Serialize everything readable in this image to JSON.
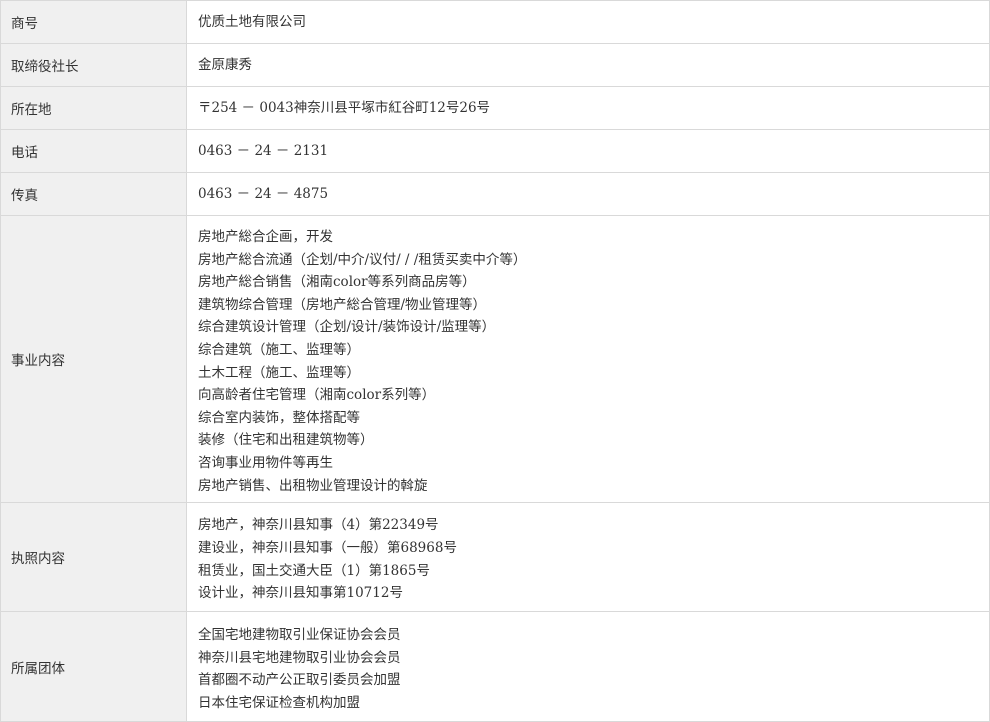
{
  "rows": [
    {
      "label": "商号",
      "lines": [
        "优质土地有限公司"
      ]
    },
    {
      "label": "取缔役社长",
      "lines": [
        "金原康秀"
      ]
    },
    {
      "label": "所在地",
      "lines": [
        "〒254 － 0043神奈川县平塚市紅谷町12号26号"
      ]
    },
    {
      "label": "电话",
      "lines": [
        "0463 － 24 － 2131"
      ]
    },
    {
      "label": "传真",
      "lines": [
        "0463 － 24 － 4875"
      ]
    },
    {
      "label": "事业内容",
      "lines": [
        "房地产総合企画，开发",
        "房地产総合流通（企划/中介/议付/ / /租赁买卖中介等）",
        "房地产総合销售（湘南color等系列商品房等）",
        "建筑物综合管理（房地产総合管理/物业管理等）",
        "综合建筑设计管理（企划/设计/装饰设计/监理等）",
        "综合建筑（施工、监理等）",
        "土木工程（施工、监理等）",
        "向高龄者住宅管理（湘南color系列等）",
        "综合室内装饰，整体搭配等",
        "装修（住宅和出租建筑物等）",
        "咨询事业用物件等再生",
        "房地产销售、出租物业管理设计的斡旋"
      ]
    },
    {
      "label": "执照内容",
      "lines": [
        "房地产，神奈川县知事（4）第22349号",
        "建设业，神奈川县知事（一般）第68968号",
        "租赁业，国土交通大臣（1）第1865号",
        "设计业，神奈川县知事第10712号"
      ]
    },
    {
      "label": "所属团体",
      "lines": [
        "全国宅地建物取引业保证协会会员",
        "神奈川县宅地建物取引业协会会员",
        "首都圈不动产公正取引委员会加盟",
        "日本住宅保证检查机构加盟"
      ]
    }
  ]
}
